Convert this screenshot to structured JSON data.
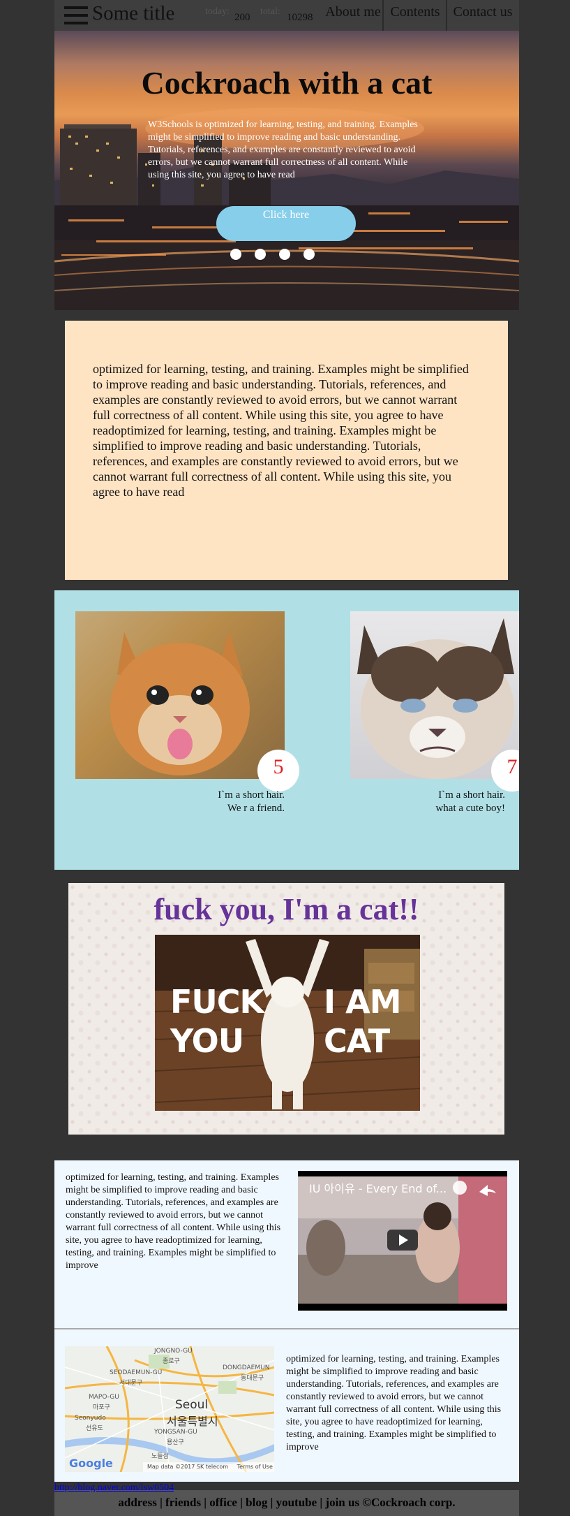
{
  "header": {
    "title": "Some title",
    "today_label": "today:",
    "today_value": "200",
    "total_label": "total:",
    "total_value": "10298",
    "nav": [
      "About me",
      "Contents",
      "Contact us"
    ]
  },
  "hero": {
    "title": "Cockroach with a cat",
    "text": "W3Schools is optimized for learning, testing, and training. Examples might be simplified to improve reading and basic understanding. Tutorials, references, and examples are constantly reviewed to avoid errors, but we cannot warrant full correctness of all content. While using this site, you agree to have read",
    "button": "Click here",
    "slides": 4
  },
  "panel_text": "optimized for learning, testing, and training. Examples might be simplified to improve reading and basic understanding. Tutorials, references, and examples are constantly reviewed to avoid errors, but we cannot warrant full correctness of all content. While using this site, you agree to have readoptimized for learning, testing, and training. Examples might be simplified to improve reading and basic understanding. Tutorials, references, and examples are constantly reviewed to avoid errors, but we cannot warrant full correctness of all content. While using this site, you agree to have read",
  "gallery": [
    {
      "count": "5",
      "caption_line1": "I`m a short hair.",
      "caption_line2": "We r a friend."
    },
    {
      "count": "7",
      "caption_line1": "I`m a short hair.",
      "caption_line2": "what a cute boy!"
    }
  ],
  "cat_section": {
    "heading": "fuck you, I'm a cat!!",
    "meme_left": [
      "FUCK",
      "YOU"
    ],
    "meme_right": [
      "I AM",
      "CAT"
    ]
  },
  "info": {
    "text_top": "optimized for learning, testing, and training. Examples might be simplified to improve reading and basic understanding. Tutorials, references, and examples are constantly reviewed to avoid errors, but we cannot warrant full correctness of all content. While using this site, you agree to have readoptimized for learning, testing, and training. Examples might be simplified to improve",
    "video_title": "IU 아이유 - Every End of...",
    "text_bottom": "optimized for learning, testing, and training. Examples might be simplified to improve reading and basic understanding. Tutorials, references, and examples are constantly reviewed to avoid errors, but we cannot warrant full correctness of all content. While using this site, you agree to have readoptimized for learning, testing, and training. Examples might be simplified to improve",
    "map": {
      "city": "Seoul",
      "city_ko": "서울특별시",
      "labels": [
        "JONGNO-GU",
        "종로구",
        "SEODAEMUN-GU",
        "서대문구",
        "DONGDAEMUN",
        "동대문구",
        "MAPO-GU",
        "마포구",
        "Seonyudo",
        "선유도",
        "YONGSAN-GU",
        "용산구",
        "노들섬"
      ],
      "google": "Google",
      "attribution": "Map data ©2017 SK telecom",
      "terms": "Terms of Use"
    }
  },
  "footer": {
    "link": "http://blog.naver.com/lsw0504",
    "text": "address | friends | office | blog | youtube | join us ©Cockroach corp."
  }
}
